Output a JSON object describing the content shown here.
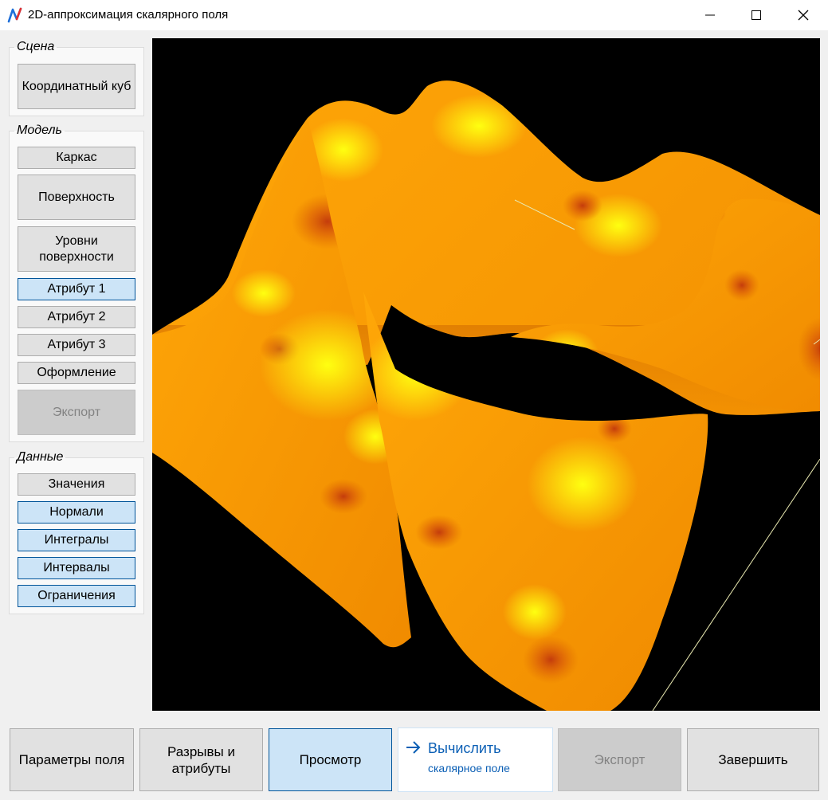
{
  "window": {
    "title": "2D-аппроксимация скалярного поля",
    "icon": "app-logo-icon",
    "controls": [
      "minimize-icon",
      "maximize-icon",
      "close-icon"
    ]
  },
  "sidebar": {
    "scene": {
      "legend": "Сцена",
      "buttons": [
        {
          "label": "Координатный куб",
          "state": "normal"
        }
      ]
    },
    "model": {
      "legend": "Модель",
      "buttons": [
        {
          "label": "Каркас",
          "state": "normal"
        },
        {
          "label": "Поверхность",
          "state": "normal"
        },
        {
          "label": "Уровни поверхности",
          "state": "normal"
        },
        {
          "label": "Атрибут 1",
          "state": "toggled"
        },
        {
          "label": "Атрибут 2",
          "state": "normal"
        },
        {
          "label": "Атрибут 3",
          "state": "normal"
        },
        {
          "label": "Оформление",
          "state": "normal"
        },
        {
          "label": "Экспорт",
          "state": "disabled"
        }
      ]
    },
    "data": {
      "legend": "Данные",
      "buttons": [
        {
          "label": "Значения",
          "state": "normal"
        },
        {
          "label": "Нормали",
          "state": "toggled"
        },
        {
          "label": "Интегралы",
          "state": "toggled"
        },
        {
          "label": "Интервалы",
          "state": "toggled"
        },
        {
          "label": "Ограничения",
          "state": "toggled"
        }
      ]
    }
  },
  "viewport": {
    "content": "3d-surface-render",
    "background": "#000000",
    "surface_colors": [
      "#ffff00",
      "#ffa500",
      "#e06a00",
      "#c04010"
    ]
  },
  "bottom_bar": {
    "field_params": "Параметры поля",
    "breaks_attrs": "Разрывы и атрибуты",
    "preview": "Просмотр",
    "compute": {
      "label": "Вычислить",
      "note": "скалярное поле",
      "icon": "arrow-right-icon"
    },
    "export": "Экспорт",
    "finish": "Завершить"
  },
  "colors": {
    "accent": "#0b5fb5",
    "toggled_bg": "#cce4f7",
    "toggled_border": "#005499"
  }
}
